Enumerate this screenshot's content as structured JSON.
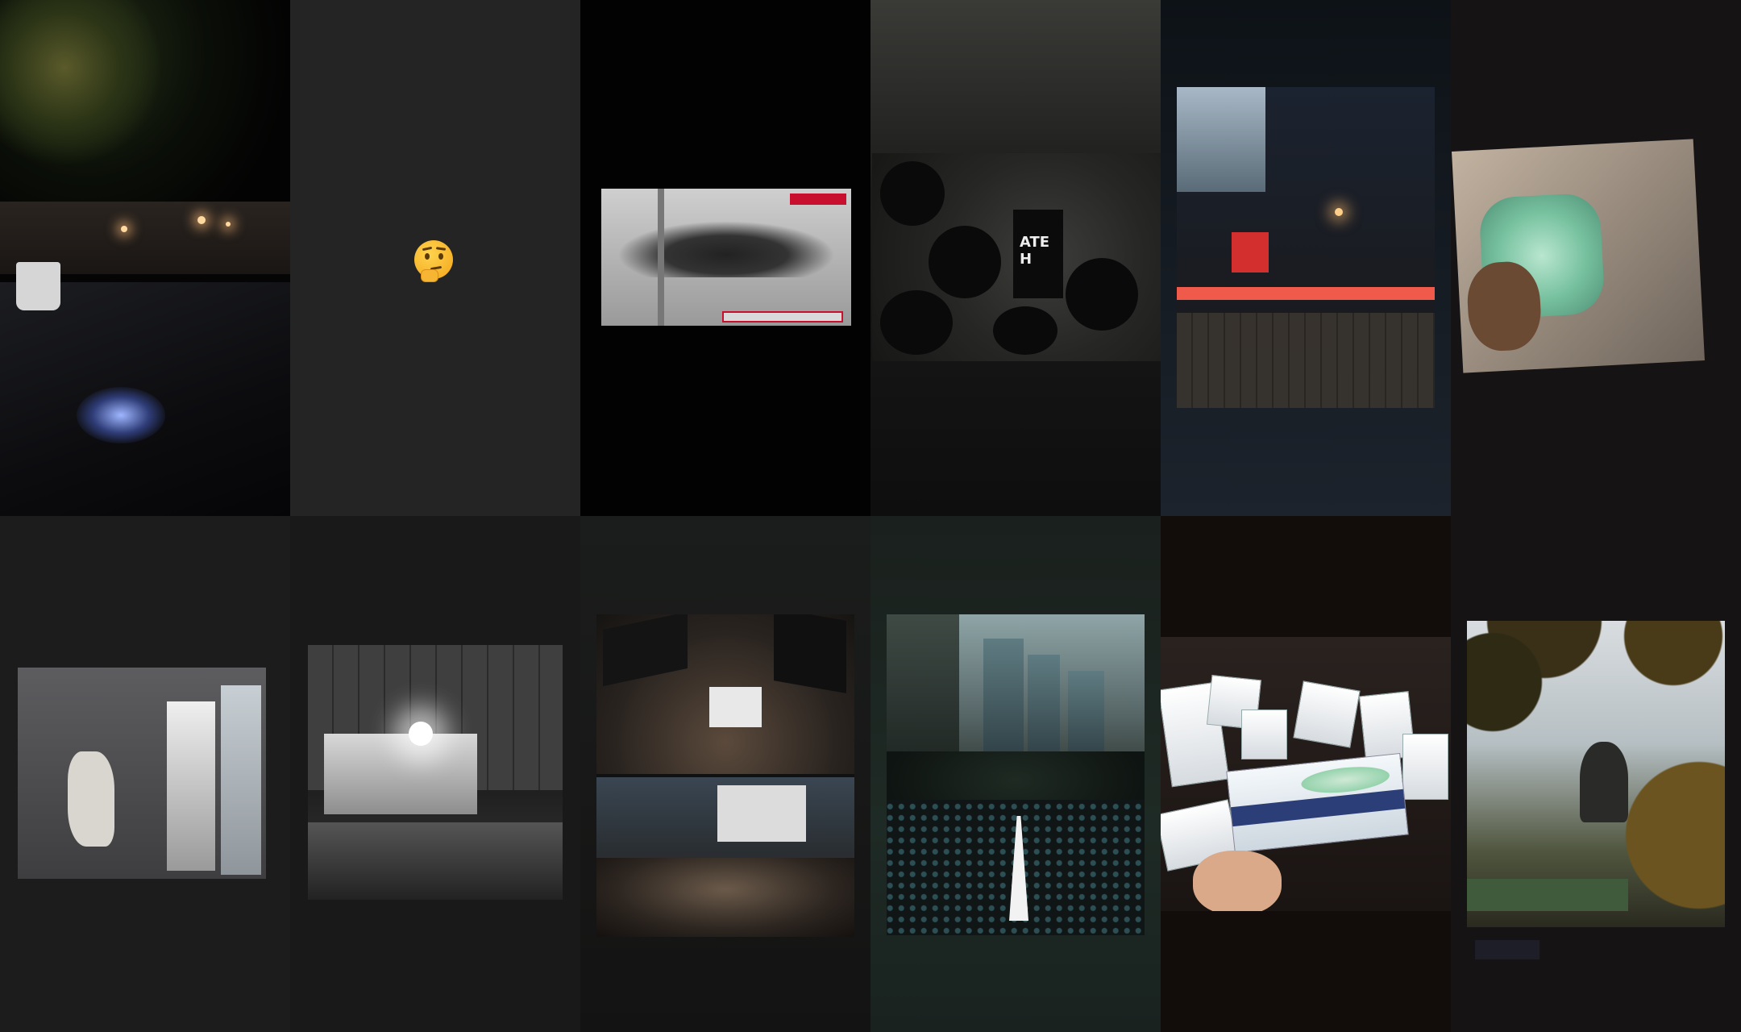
{
  "grid": {
    "rows": 2,
    "columns": 6,
    "tiles": [
      {
        "id": "tile-1",
        "subject": "night-drive"
      },
      {
        "id": "tile-2",
        "subject": "thinking-emoji"
      },
      {
        "id": "tile-3",
        "subject": "tv-news-clip"
      },
      {
        "id": "tile-4",
        "subject": "crowd-overhead"
      },
      {
        "id": "tile-5",
        "subject": "night-street-tape"
      },
      {
        "id": "tile-6",
        "subject": "masks-in-hand"
      },
      {
        "id": "tile-7",
        "subject": "broken-wall-doorway"
      },
      {
        "id": "tile-8",
        "subject": "water-cannon-truck"
      },
      {
        "id": "tile-9",
        "subject": "protest-flags-collage"
      },
      {
        "id": "tile-10",
        "subject": "city-crowd-umbrellas"
      },
      {
        "id": "tile-11",
        "subject": "surgical-mask-boxes"
      },
      {
        "id": "tile-12",
        "subject": "buddha-statue"
      }
    ]
  },
  "tile_text": {
    "sign_text": "ATE H",
    "emoji": "🤔"
  },
  "colors": {
    "background": "#111111",
    "tape_red": "#f05a4a",
    "mask_band": "#2c3e78"
  }
}
